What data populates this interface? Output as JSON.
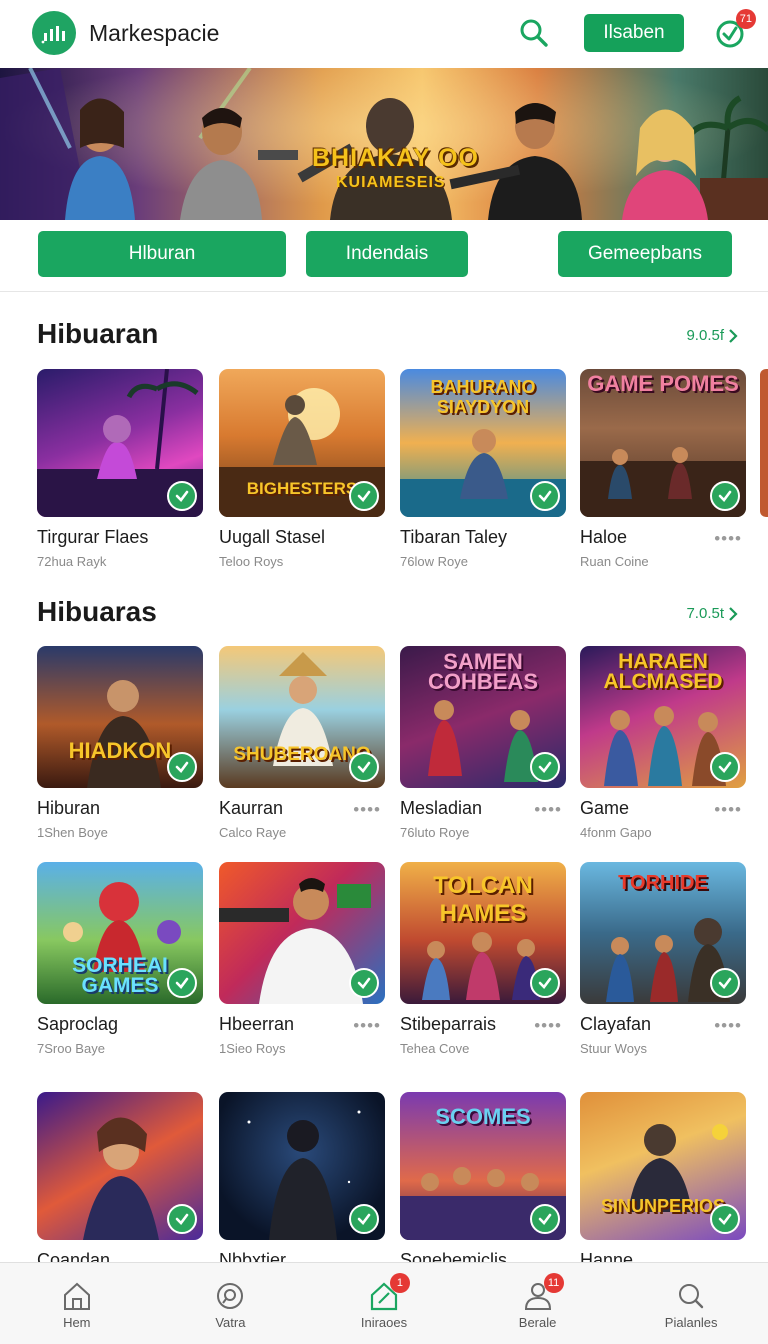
{
  "header": {
    "app_title": "Markespacie",
    "cta_label": "Ilsaben",
    "notification_count": "71",
    "logo_icon": "chart-bars-icon",
    "accent_color": "#1aa660"
  },
  "hero": {
    "title": "BHIAKAY OO",
    "subtitle": "KUIAMESEIS"
  },
  "tabs": [
    {
      "label": "Hlburan"
    },
    {
      "label": "Indendais"
    },
    {
      "label": "Gemeepbans"
    }
  ],
  "section1": {
    "title": "Hibuaran",
    "see_all": "9.0.5f",
    "cards": [
      {
        "title": "Tirgurar Flaes",
        "sub": "72hua Rayk",
        "art": ""
      },
      {
        "title": "Uugall Stasel",
        "sub": "Teloo Roys",
        "art": "BIGHESTERS"
      },
      {
        "title": "Tibaran Taley",
        "sub": "76low Roye",
        "art": "BAHURANO SIAYDYON"
      },
      {
        "title": "Haloe",
        "sub": "Ruan Coine",
        "art": "GAME POMES"
      }
    ]
  },
  "section2": {
    "title": "Hibuaras",
    "see_all": "7.0.5t",
    "cards": [
      {
        "title": "Hiburan",
        "sub": "1Shen Boye",
        "art": "HIADKON"
      },
      {
        "title": "Kaurran",
        "sub": "Calco Raye",
        "art": "SHUBEROANO"
      },
      {
        "title": "Mesladian",
        "sub": "76luto Roye",
        "art": "SAMEN COHBEAS"
      },
      {
        "title": "Game",
        "sub": "4fonm Gapo",
        "art": "HARAEN ALCMASED"
      },
      {
        "title": "Saproclag",
        "sub": "7Sroo Baye",
        "art": "SORHEAI GAMES"
      },
      {
        "title": "Hbeerran",
        "sub": "1Sieo Roys",
        "art": ""
      },
      {
        "title": "Stibeparrais",
        "sub": "Tehea Cove",
        "art": "TOLCAN HAMES"
      },
      {
        "title": "Clayafan",
        "sub": "Stuur Woys",
        "art": "TORHIDE"
      },
      {
        "title": "Coandan",
        "sub": "",
        "art": ""
      },
      {
        "title": "Nbbxtier",
        "sub": "",
        "art": ""
      },
      {
        "title": "Sonebemiclis",
        "sub": "",
        "art": "SCOMES"
      },
      {
        "title": "Hanne",
        "sub": "",
        "art": "SINUNPERIOS"
      }
    ]
  },
  "bottom_nav": [
    {
      "label": "Hem",
      "icon": "home-icon",
      "badge": ""
    },
    {
      "label": "Vatra",
      "icon": "search-circle-icon",
      "badge": ""
    },
    {
      "label": "Iniraoes",
      "icon": "house-active-icon",
      "badge": "1"
    },
    {
      "label": "Berale",
      "icon": "profile-icon",
      "badge": "11"
    },
    {
      "label": "Pialanles",
      "icon": "search-icon",
      "badge": ""
    }
  ]
}
